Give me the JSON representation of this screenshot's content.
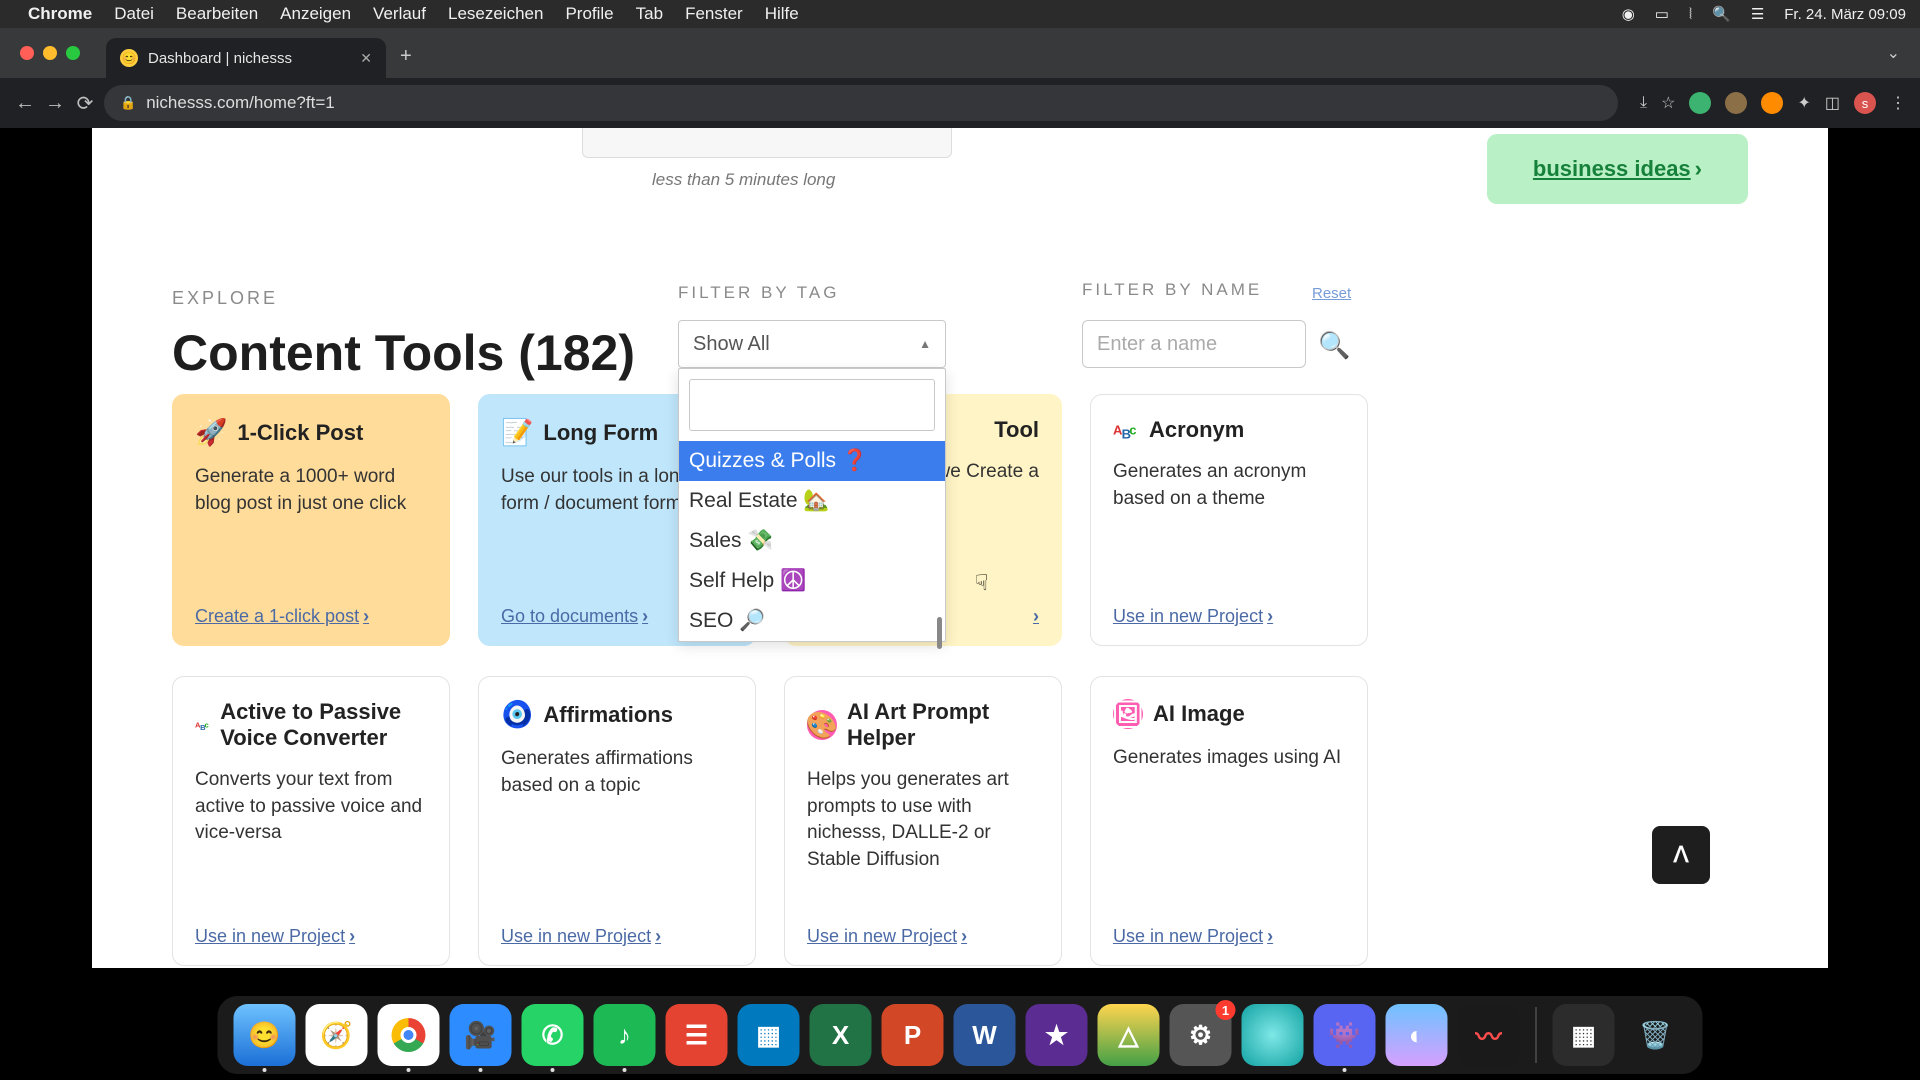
{
  "menubar": {
    "app": "Chrome",
    "items": [
      "Datei",
      "Bearbeiten",
      "Anzeigen",
      "Verlauf",
      "Lesezeichen",
      "Profile",
      "Tab",
      "Fenster",
      "Hilfe"
    ],
    "clock": "Fr. 24. März 09:09"
  },
  "browser": {
    "tab_title": "Dashboard | nichesss",
    "url": "nichesss.com/home?ft=1"
  },
  "top": {
    "caption": "less than 5 minutes long",
    "biz_link": "business ideas"
  },
  "headers": {
    "explore": "EXPLORE",
    "title": "Content Tools (182)",
    "filter_tag": "FILTER BY TAG",
    "filter_name": "FILTER BY NAME",
    "reset": "Reset"
  },
  "dropdown": {
    "selected": "Show All",
    "options": [
      {
        "label": "Quizzes & Polls ❓",
        "selected": true
      },
      {
        "label": "Real Estate 🏡"
      },
      {
        "label": "Sales 💸"
      },
      {
        "label": "Self Help ☮️"
      },
      {
        "label": "SEO 🔎"
      }
    ]
  },
  "name_filter": {
    "placeholder": "Enter a name"
  },
  "cards_row1": [
    {
      "emoji": "🚀",
      "title": "1-Click Post",
      "desc": "Generate a 1000+ word blog post in just one click",
      "action": "Create a 1-click post",
      "bg": "orange"
    },
    {
      "emoji": "📝",
      "title": "Long Form",
      "desc": "Use our tools in a long form / document format",
      "action": "Go to documents",
      "bg": "blue"
    },
    {
      "emoji": "",
      "title": "Tool",
      "desc": "we Create a",
      "action": "",
      "bg": "yellow"
    },
    {
      "emoji": "",
      "title": "Acronym",
      "desc": "Generates an acronym based on a theme",
      "action": "Use in new Project",
      "bg": "white"
    }
  ],
  "cards_row2": [
    {
      "emoji": "",
      "title": "Active to Passive Voice Converter",
      "desc": "Converts your text from active to passive voice and vice-versa",
      "action": "Use in new Project"
    },
    {
      "emoji": "🧿",
      "title": "Affirmations",
      "desc": "Generates affirmations based on a topic",
      "action": "Use in new Project"
    },
    {
      "emoji": "🎨",
      "title": "AI Art Prompt Helper",
      "desc": "Helps you generates art prompts to use with nichesss, DALLE-2 or Stable Diffusion",
      "action": "Use in new Project"
    },
    {
      "emoji": "🖼",
      "title": "AI Image",
      "desc": "Generates images using AI",
      "action": "Use in new Project"
    }
  ],
  "dock_apps": [
    "finder",
    "safari",
    "chrome",
    "zoom",
    "whatsapp",
    "spotify",
    "todoist",
    "trello",
    "excel",
    "powerpoint",
    "word",
    "imovie",
    "drive",
    "settings",
    "app1",
    "discord",
    "app2",
    "app3"
  ],
  "dock_badge_index": 13
}
